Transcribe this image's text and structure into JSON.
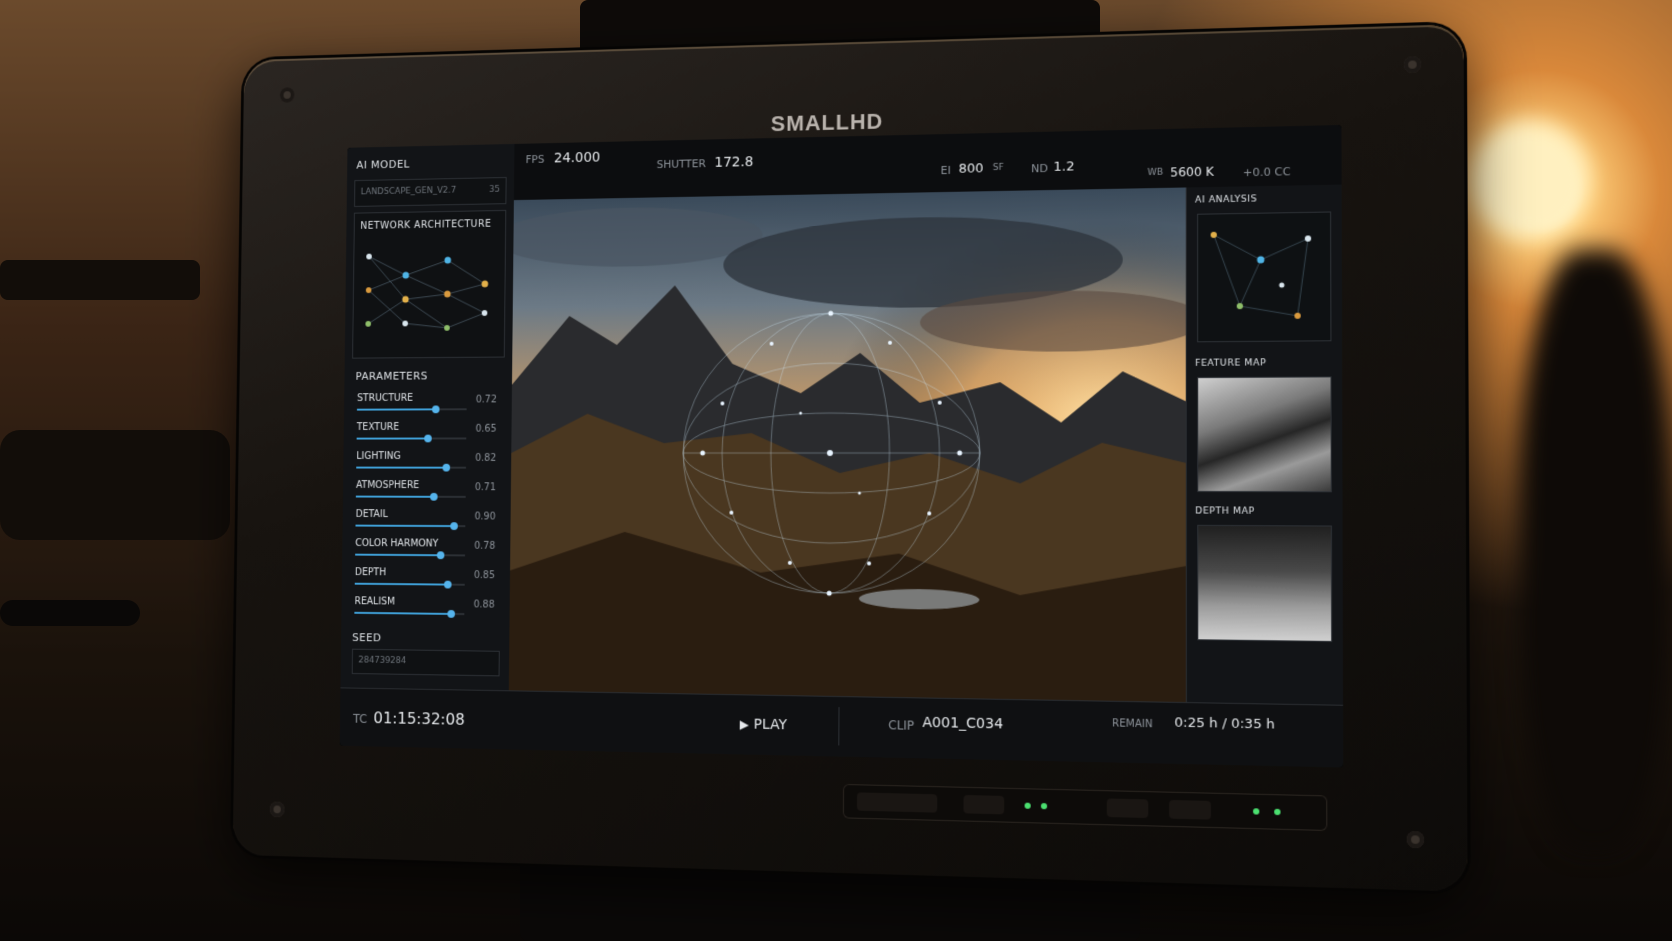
{
  "brand": "SMALLHD",
  "left_panel": {
    "model_label": "AI MODEL",
    "model_value": "LANDSCAPE_GEN_V2.7",
    "model_suffix": "35",
    "network_title": "NETWORK ARCHITECTURE",
    "params_title": "PARAMETERS",
    "params": [
      {
        "name": "STRUCTURE",
        "value": "0.72",
        "level": 0.72
      },
      {
        "name": "TEXTURE",
        "value": "0.65",
        "level": 0.65
      },
      {
        "name": "LIGHTING",
        "value": "0.82",
        "level": 0.82
      },
      {
        "name": "ATMOSPHERE",
        "value": "0.71",
        "level": 0.71
      },
      {
        "name": "DETAIL",
        "value": "0.90",
        "level": 0.9
      },
      {
        "name": "COLOR HARMONY",
        "value": "0.78",
        "level": 0.78
      },
      {
        "name": "DEPTH",
        "value": "0.85",
        "level": 0.85
      },
      {
        "name": "REALISM",
        "value": "0.88",
        "level": 0.88
      }
    ],
    "seed_title": "SEED",
    "seed_value": "284739284"
  },
  "top_bar": {
    "fps_label": "FPS",
    "fps_value": "24.000",
    "shutter_label": "SHUTTER",
    "shutter_value": "172.8",
    "ei_label": "EI",
    "ei_value": "800",
    "ei_suffix": "SF",
    "nd_label": "ND",
    "nd_value": "1.2",
    "wb_label": "WB",
    "wb_value": "5600 K",
    "cc_value": "+0.0 CC"
  },
  "right_panel": {
    "analysis_title": "AI ANALYSIS",
    "feature_title": "FEATURE MAP",
    "depth_title": "DEPTH MAP"
  },
  "bottom_bar": {
    "tc_label": "TC",
    "tc_value": "01:15:32:08",
    "play_label": "PLAY",
    "clip_label": "CLIP",
    "clip_value": "A001_C034",
    "remain_label": "REMAIN",
    "remain_value": "0:25 h / 0:35 h"
  },
  "colors": {
    "accent": "#3fa0d8",
    "screen_bg": "#0c0d0f",
    "bezel": "#17130f"
  }
}
